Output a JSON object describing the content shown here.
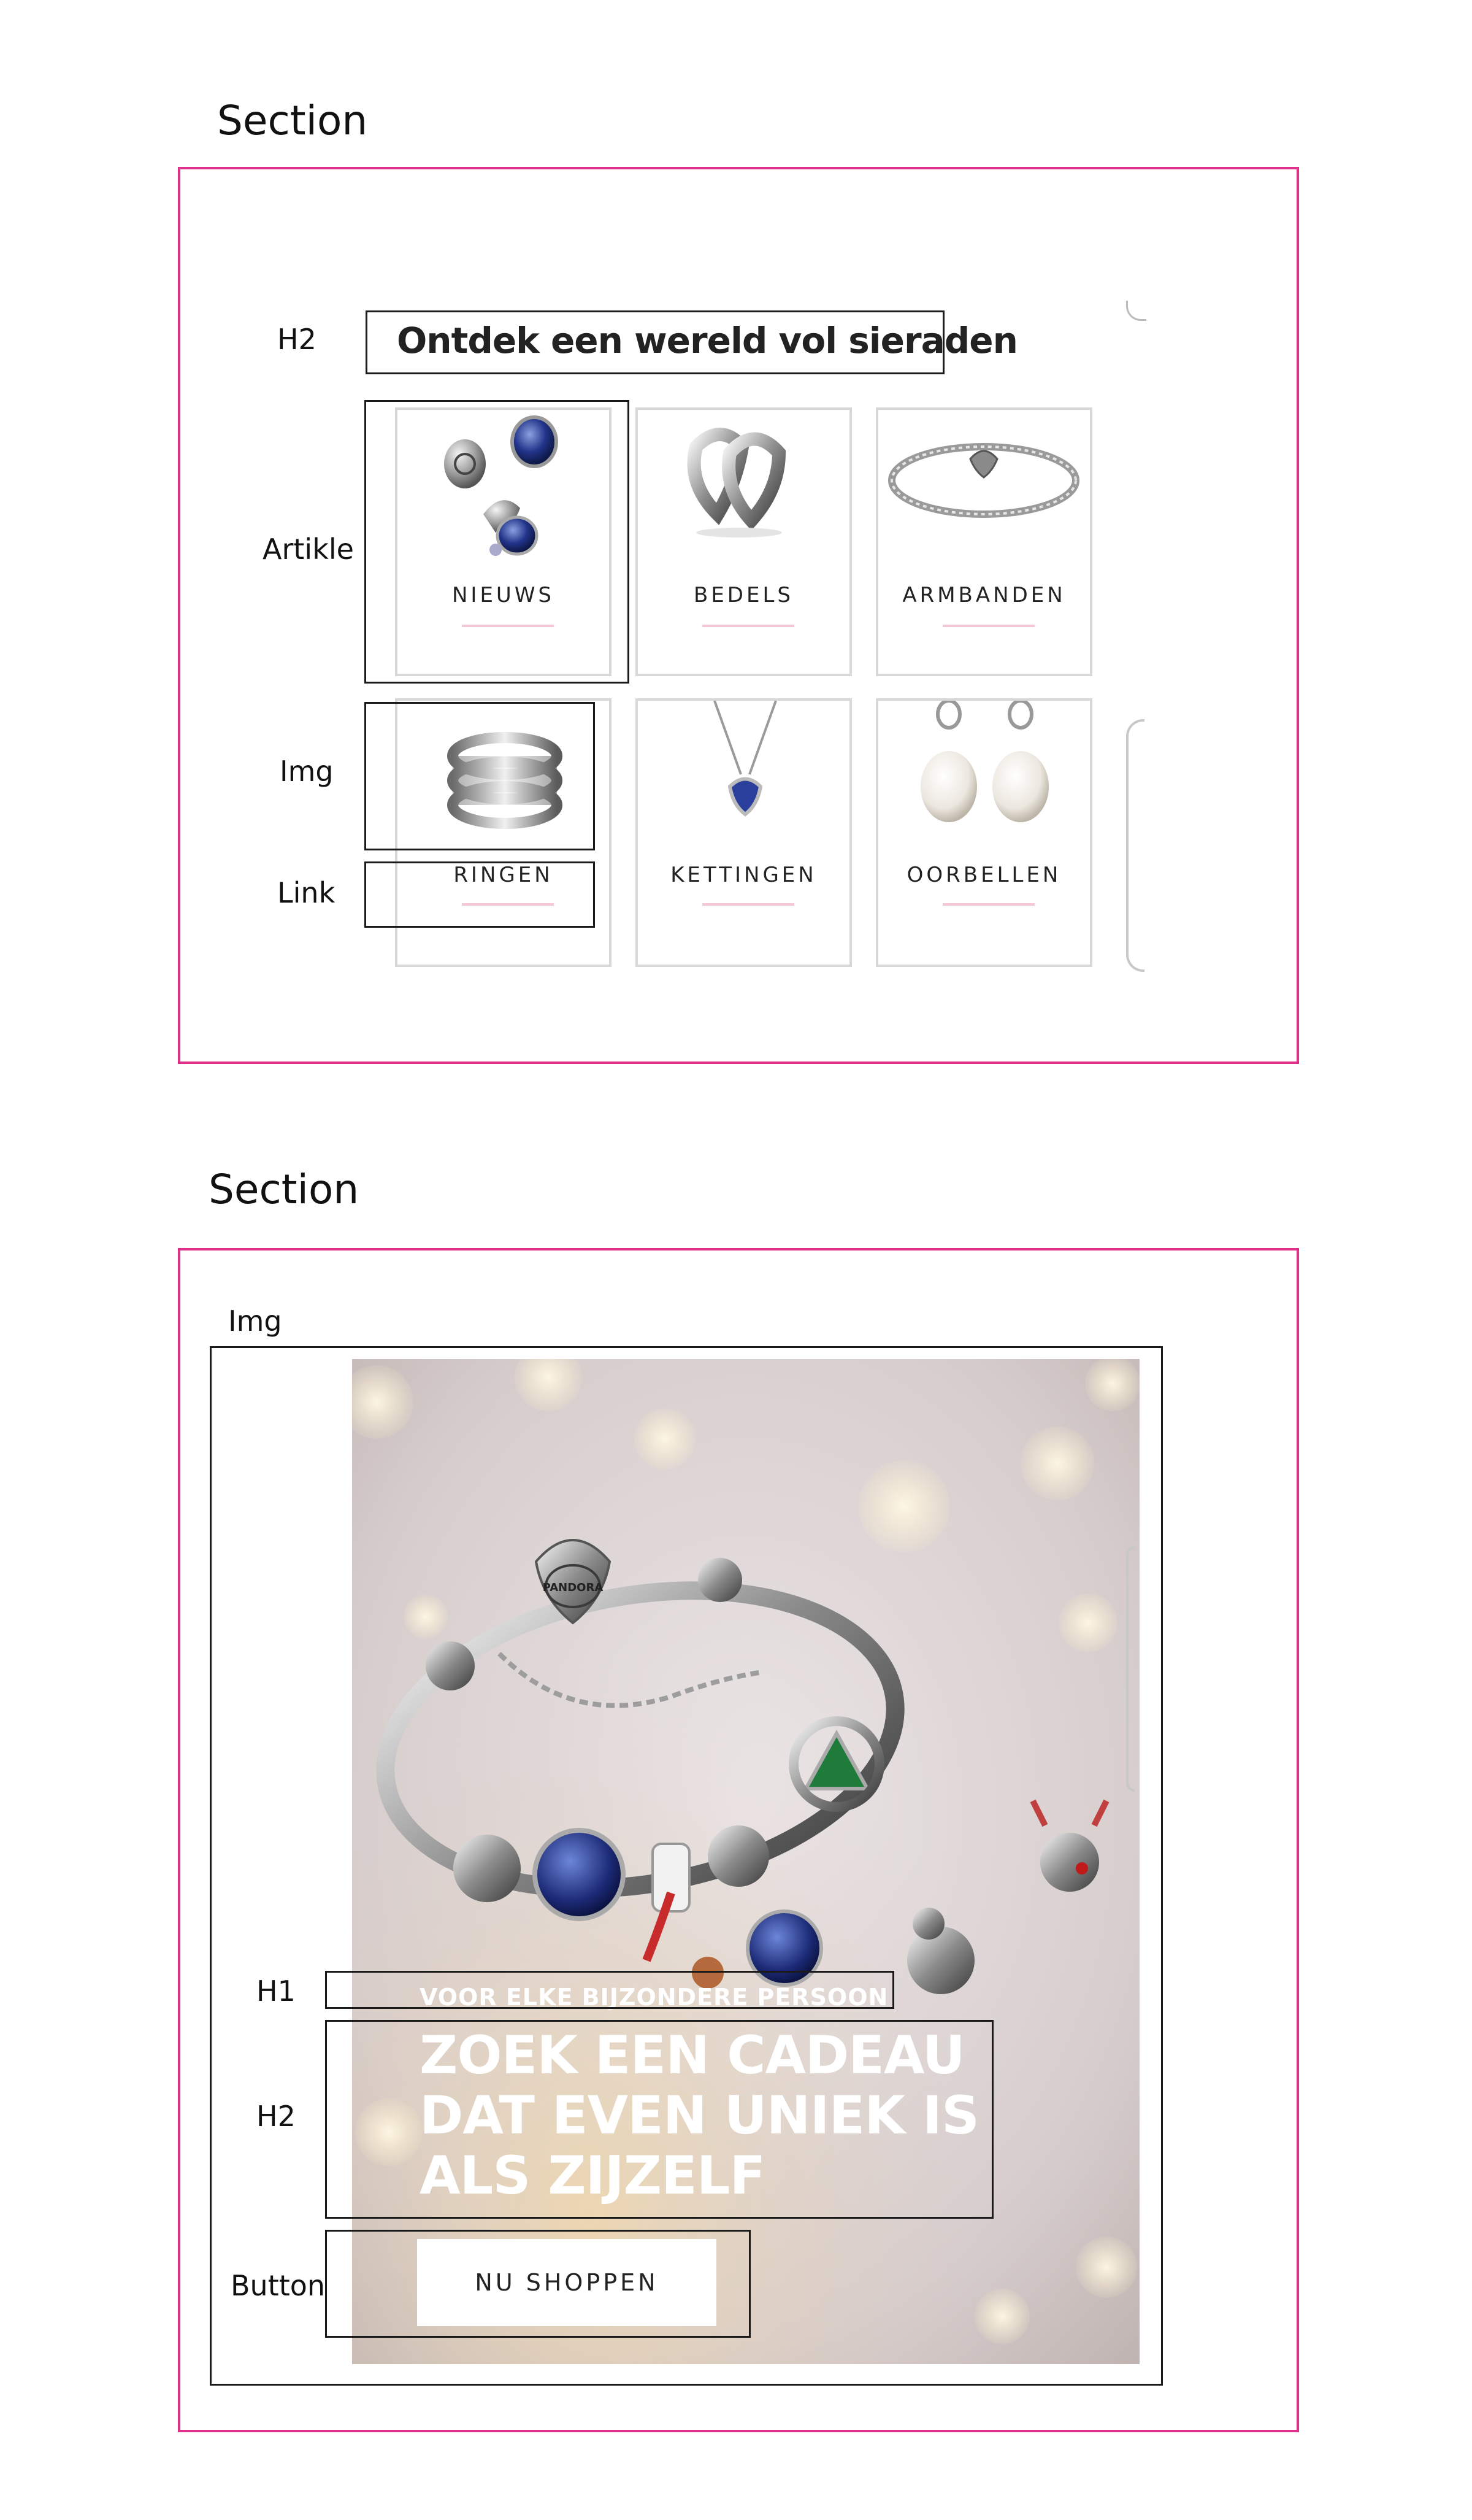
{
  "section1": {
    "title": "Section",
    "annotations": {
      "h2": "H2",
      "article": "Artikle",
      "img": "Img",
      "link": "Link"
    },
    "heading": "Ontdek een wereld vol sieraden",
    "categories": [
      {
        "label": "NIEUWS",
        "icon": "charms-mix-icon"
      },
      {
        "label": "BEDELS",
        "icon": "heart-rings-charm-icon"
      },
      {
        "label": "ARMBANDEN",
        "icon": "bracelet-icon"
      },
      {
        "label": "RINGEN",
        "icon": "stacked-rings-icon"
      },
      {
        "label": "KETTINGEN",
        "icon": "heart-necklace-icon"
      },
      {
        "label": "OORBELLEN",
        "icon": "pearl-earrings-icon"
      }
    ]
  },
  "section2": {
    "title": "Section",
    "annotations": {
      "img": "Img",
      "h1": "H1",
      "h2": "H2",
      "button": "Button"
    },
    "hero": {
      "eyebrow": "VOOR ELKE BIJZONDERE PERSOON",
      "headline": "ZOEK EEN CADEAU DAT EVEN UNIEK IS ALS ZIJZELF",
      "cta": "NU SHOPPEN",
      "brand_engraving": "PANDORA"
    }
  },
  "colors": {
    "section_border": "#e0308a",
    "link_underline": "#f5c6d8",
    "card_border": "#d8d8d8"
  }
}
